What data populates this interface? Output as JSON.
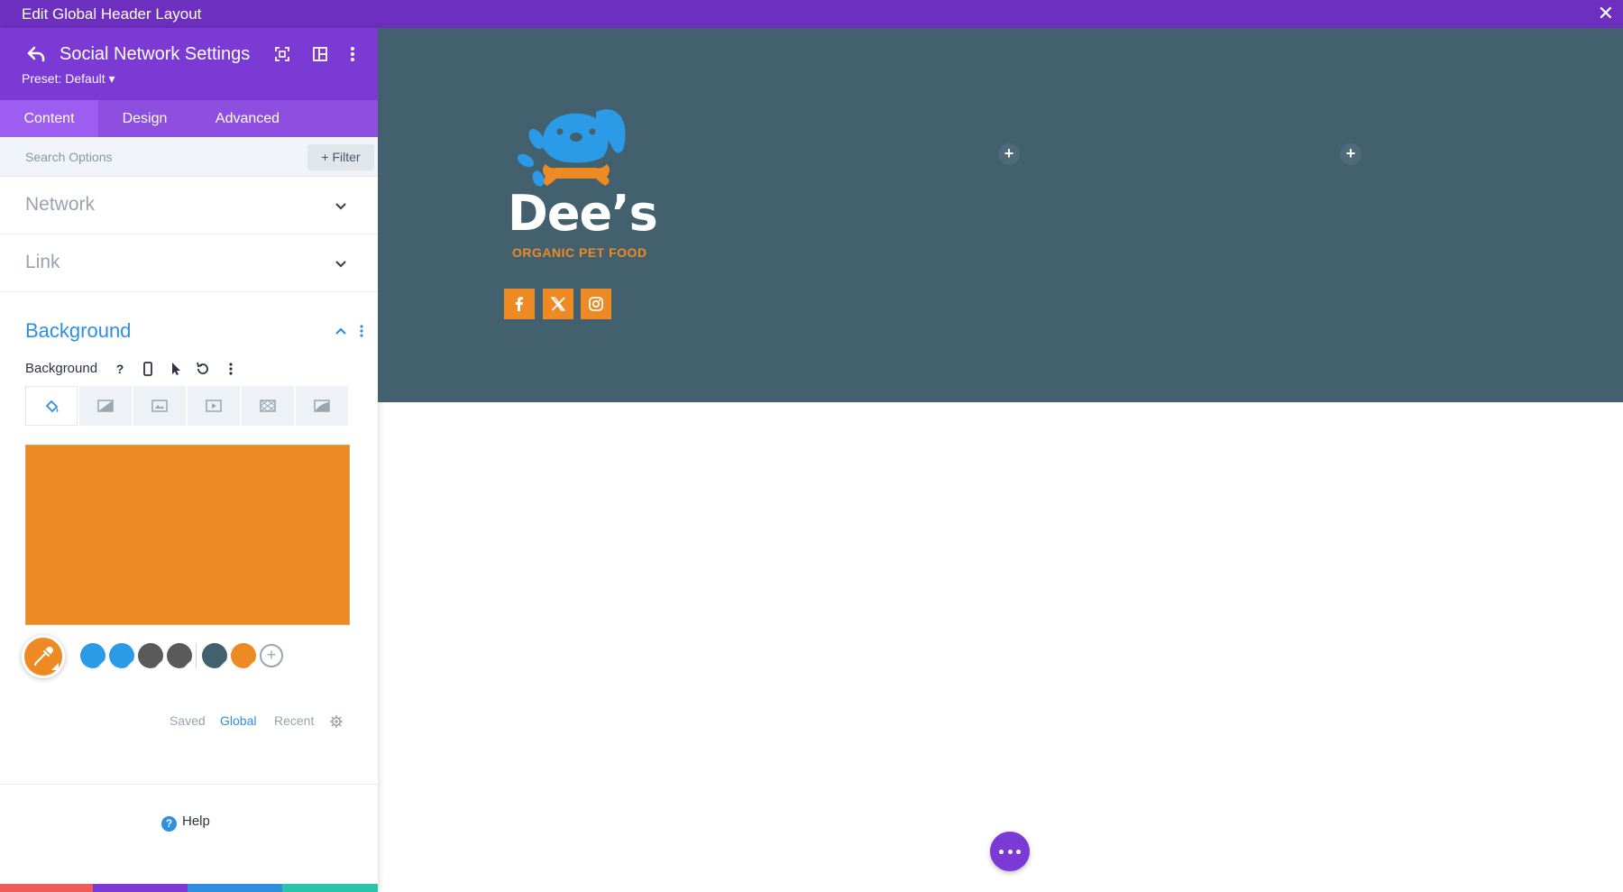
{
  "window": {
    "title": "Edit Global Header Layout",
    "close_glyph": "✕"
  },
  "panel": {
    "title": "Social Network Settings",
    "preset": "Preset: Default ▾",
    "tabs": [
      {
        "label": "Content",
        "active": true
      },
      {
        "label": "Design",
        "active": false
      },
      {
        "label": "Advanced",
        "active": false
      }
    ],
    "search": {
      "placeholder": "Search Options",
      "filter_label": "+ Filter"
    },
    "sections": [
      {
        "label": "Network",
        "expanded": false
      },
      {
        "label": "Link",
        "expanded": false
      },
      {
        "label": "Background",
        "expanded": true
      }
    ],
    "background": {
      "option_label": "Background",
      "help_glyph": "?",
      "types": [
        "paint-bucket-icon",
        "gradient-icon",
        "image-icon",
        "video-icon",
        "pattern-icon",
        "mask-icon"
      ],
      "color": "#ee8a23",
      "swatches": [
        "#2b9be8",
        "#2b9be8",
        "#5a5a5a",
        "#5a5a5a",
        "#43606f",
        "#ee8a23"
      ],
      "add_glyph": "+",
      "palette_tabs": [
        {
          "label": "Saved",
          "active": false
        },
        {
          "label": "Global",
          "active": true
        },
        {
          "label": "Recent",
          "active": false
        }
      ]
    },
    "help_label": "Help",
    "help_glyph": "?",
    "actions": [
      {
        "name": "discard",
        "color": "#ef5a5a"
      },
      {
        "name": "undo",
        "color": "#7b3ad4"
      },
      {
        "name": "redo",
        "color": "#2e8ee0"
      },
      {
        "name": "save",
        "color": "#29c4a9"
      }
    ]
  },
  "canvas": {
    "background": "#43606f",
    "logo": {
      "wordmark": "Dee’s",
      "tagline": "ORGANIC PET FOOD"
    },
    "social_icons": [
      "facebook-icon",
      "x-icon",
      "instagram-icon"
    ],
    "social_bg": "#ee8a23",
    "add_glyph": "+"
  },
  "colors": {
    "purple_dark": "#6d2fbf",
    "purple": "#7b3ad4",
    "accent_blue": "#2e8ee0",
    "orange": "#ee8a23"
  }
}
